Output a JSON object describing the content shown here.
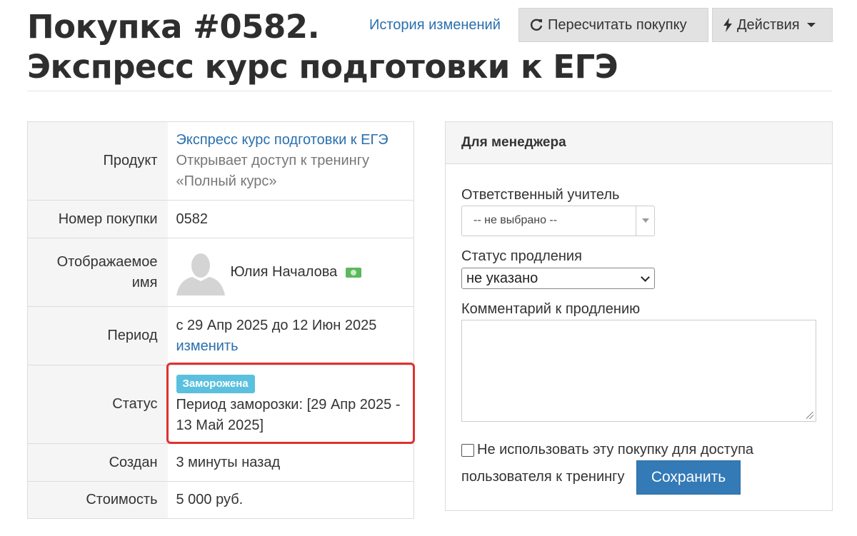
{
  "header": {
    "title_line1": "Покупка #0582.",
    "title_line2": "Экспресс курс подготовки к ЕГЭ",
    "history_link": "История изменений",
    "recalc_button": "Пересчитать покупку",
    "actions_button": "Действия"
  },
  "details": {
    "product_label": "Продукт",
    "product_name": "Экспресс курс подготовки к ЕГЭ",
    "product_desc": "Открывает доступ к тренингу «Полный курс»",
    "number_label": "Номер покупки",
    "number_value": "0582",
    "display_name_label": "Отображаемое имя",
    "user_name": "Юлия Началова",
    "period_label": "Период",
    "period_value": "с 29 Апр 2025 до 12 Июн 2025",
    "period_change_link": "изменить",
    "status_label": "Статус",
    "status_badge": "Заморожена",
    "freeze_period": "Период заморозки: [29 Апр 2025 - 13 Май 2025]",
    "created_label": "Создан",
    "created_value": "3 минуты назад",
    "cost_label": "Стоимость",
    "cost_value": "5 000 руб."
  },
  "manager": {
    "heading": "Для менеджера",
    "teacher_label": "Ответственный учитель",
    "teacher_value": "-- не выбрано --",
    "renewal_status_label": "Статус продления",
    "renewal_status_value": "не указано",
    "renewal_comment_label": "Комментарий к продлению",
    "no_access_label_line1": "Не использовать эту покупку для доступа",
    "no_access_label_line2": "пользователя к тренингу",
    "save_button": "Сохранить"
  },
  "colors": {
    "link": "#2a6fae",
    "badge": "#5bc0de",
    "primary_button": "#337ab7",
    "highlight_frame": "#e0312f"
  },
  "icons": [
    "refresh-icon",
    "lightning-icon",
    "caret-down-icon",
    "avatar-placeholder-icon",
    "money-icon",
    "chevron-down-icon"
  ]
}
